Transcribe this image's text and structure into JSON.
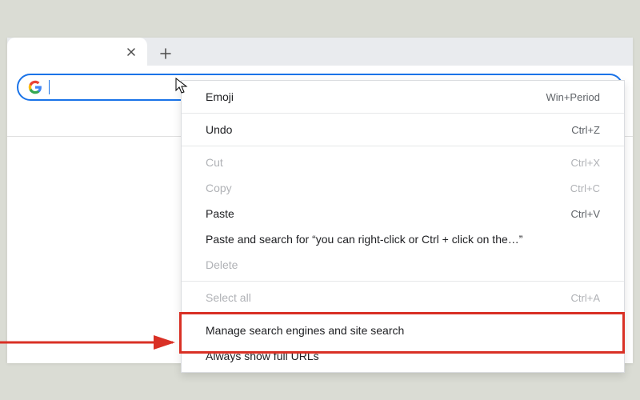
{
  "context_menu": {
    "items": [
      {
        "label": "Emoji",
        "shortcut": "Win+Period",
        "enabled": true
      },
      {
        "sep": true
      },
      {
        "label": "Undo",
        "shortcut": "Ctrl+Z",
        "enabled": true
      },
      {
        "sep": true
      },
      {
        "label": "Cut",
        "shortcut": "Ctrl+X",
        "enabled": false
      },
      {
        "label": "Copy",
        "shortcut": "Ctrl+C",
        "enabled": false
      },
      {
        "label": "Paste",
        "shortcut": "Ctrl+V",
        "enabled": true
      },
      {
        "label": "Paste and search for “you can right-click or Ctrl + click on the…”",
        "shortcut": "",
        "enabled": true
      },
      {
        "label": "Delete",
        "shortcut": "",
        "enabled": false
      },
      {
        "sep": true
      },
      {
        "label": "Select all",
        "shortcut": "Ctrl+A",
        "enabled": false
      },
      {
        "sep": true
      },
      {
        "label": "Manage search engines and site search",
        "shortcut": "",
        "enabled": true
      },
      {
        "label": "Always show full URLs",
        "shortcut": "",
        "enabled": true
      }
    ]
  },
  "omnibox": {
    "value": "",
    "placeholder": ""
  },
  "colors": {
    "accent": "#1a73e8",
    "highlight": "#d93025"
  }
}
